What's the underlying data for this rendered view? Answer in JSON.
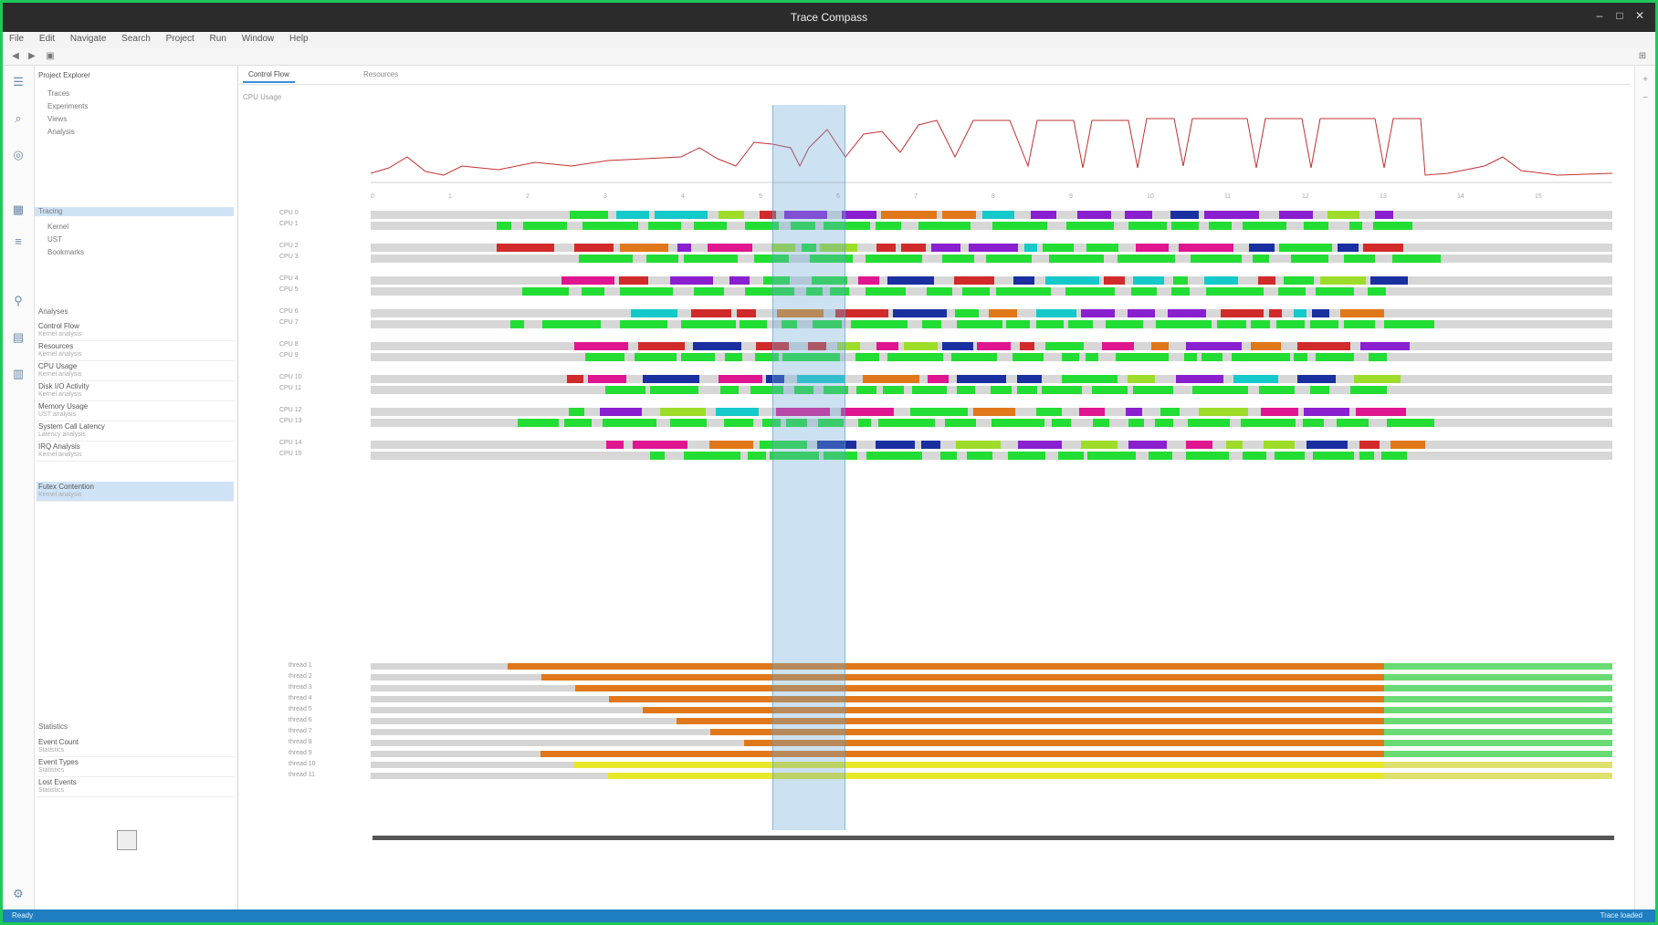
{
  "window": {
    "title": "Trace Compass",
    "controls": [
      "–",
      "□",
      "✕"
    ]
  },
  "menubar": {
    "items": [
      "File",
      "Edit",
      "Navigate",
      "Search",
      "Project",
      "Run",
      "Window",
      "Help"
    ]
  },
  "left_panel": {
    "section_title": "Project Explorer",
    "selected_item": "Tracing",
    "tree_items": [
      "Traces",
      "Experiments",
      "Views",
      "Analysis",
      "Tracing",
      "Kernel",
      "UST",
      "Bookmarks"
    ],
    "list_header": "Analyses",
    "list_items": [
      {
        "title": "Control Flow",
        "subtitle": "Kernel analysis"
      },
      {
        "title": "Resources",
        "subtitle": "Kernel analysis"
      },
      {
        "title": "CPU Usage",
        "subtitle": "Kernel analysis"
      },
      {
        "title": "Disk I/O Activity",
        "subtitle": "Kernel analysis"
      },
      {
        "title": "Memory Usage",
        "subtitle": "UST analysis"
      },
      {
        "title": "System Call Latency",
        "subtitle": "Latency analysis"
      },
      {
        "title": "IRQ Analysis",
        "subtitle": "Kernel analysis"
      },
      {
        "title": "Futex Contention",
        "subtitle": "Kernel analysis"
      }
    ],
    "lower_header": "Statistics",
    "lower_items": [
      {
        "title": "Event Count",
        "subtitle": "Statistics"
      },
      {
        "title": "Event Types",
        "subtitle": "Statistics"
      },
      {
        "title": "Lost Events",
        "subtitle": "Statistics"
      }
    ]
  },
  "main": {
    "tabs": [
      "Control Flow",
      "Resources"
    ],
    "upper_rows": [
      "CPU 0",
      "CPU 1",
      "CPU 2",
      "CPU 3",
      "CPU 4",
      "CPU 5",
      "CPU 6",
      "CPU 7",
      "CPU 8",
      "CPU 9",
      "CPU 10",
      "CPU 11",
      "CPU 12",
      "CPU 13",
      "CPU 14",
      "CPU 15"
    ],
    "lower_rows": [
      "thread 1",
      "thread 2",
      "thread 3",
      "thread 4",
      "thread 5",
      "thread 6",
      "thread 7",
      "thread 8",
      "thread 9",
      "thread 10",
      "thread 11"
    ],
    "axis_labels": [
      "0",
      "1",
      "2",
      "3",
      "4",
      "5",
      "6",
      "7",
      "8",
      "9",
      "10",
      "11",
      "12",
      "13",
      "14",
      "15"
    ],
    "chart_label": "CPU Usage"
  },
  "status": {
    "left": "Ready",
    "right": "Trace loaded"
  },
  "palette": {
    "green": "#22dd33",
    "purple": "#8a1fcf",
    "navy": "#1a2fa0",
    "red": "#d02a2a",
    "cyan": "#14c9c9",
    "magenta": "#e01690",
    "lime": "#9edc2a",
    "orange": "#e0781a",
    "yellow": "#e8e82a",
    "selection": "#6aaad7",
    "status_bar": "#1f7ec0",
    "frame": "#1ec85a"
  }
}
